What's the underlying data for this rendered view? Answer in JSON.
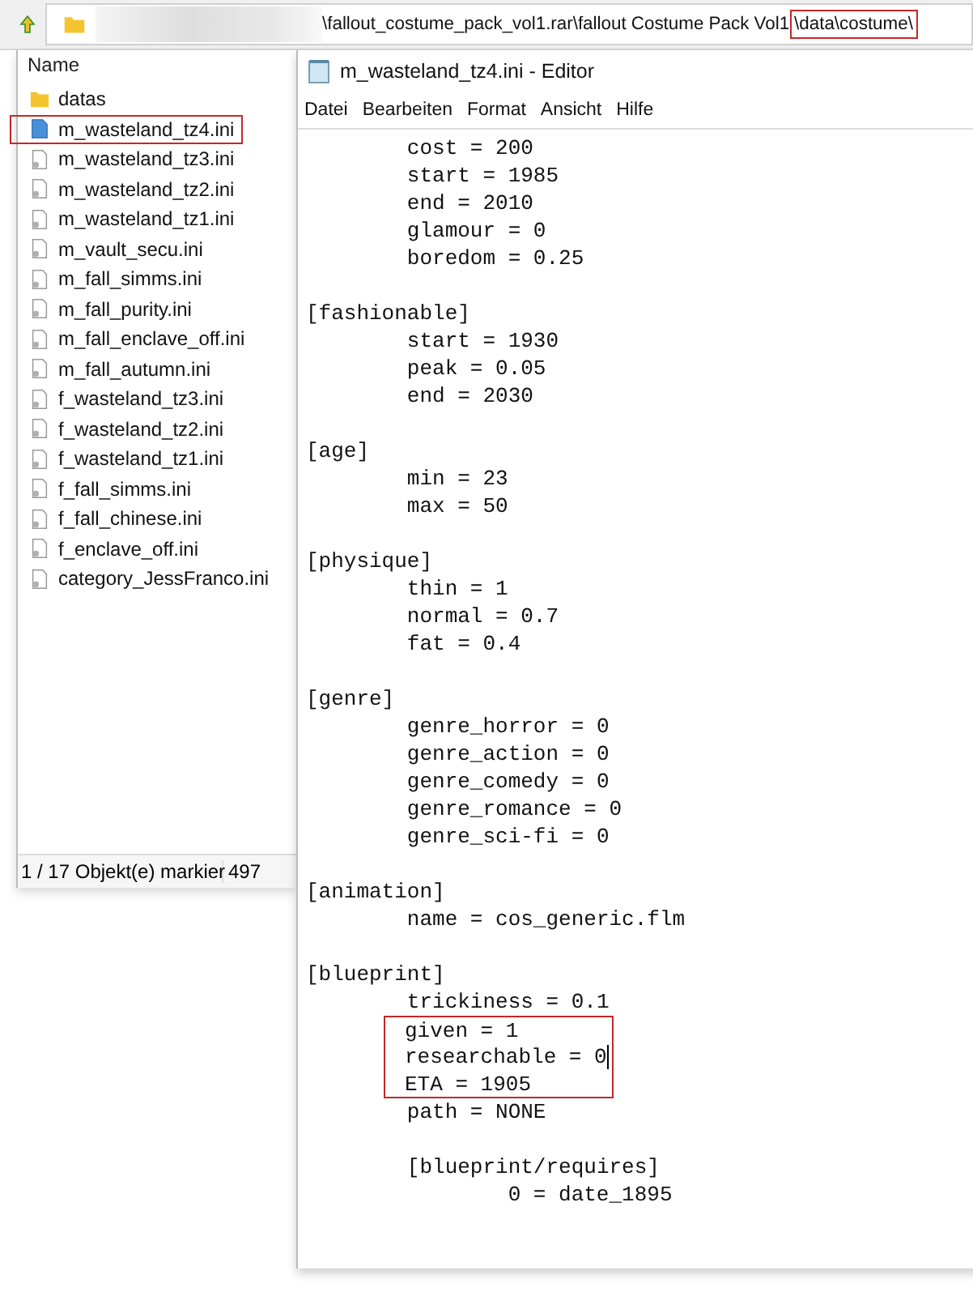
{
  "explorer": {
    "address": {
      "segments": [
        {
          "text": "\\fallout_costume_pack_vol1.rar\\fallout Costume Pack Vol1",
          "highlighted": false
        },
        {
          "text": "\\data\\costume\\",
          "highlighted": true
        }
      ]
    },
    "list": {
      "header": "Name",
      "items": [
        {
          "name": "datas",
          "kind": "folder",
          "highlighted": false
        },
        {
          "name": "m_wasteland_tz4.ini",
          "kind": "notepad_file",
          "highlighted": true
        },
        {
          "name": "m_wasteland_tz3.ini",
          "kind": "file",
          "highlighted": false
        },
        {
          "name": "m_wasteland_tz2.ini",
          "kind": "file",
          "highlighted": false
        },
        {
          "name": "m_wasteland_tz1.ini",
          "kind": "file",
          "highlighted": false
        },
        {
          "name": "m_vault_secu.ini",
          "kind": "file",
          "highlighted": false
        },
        {
          "name": "m_fall_simms.ini",
          "kind": "file",
          "highlighted": false
        },
        {
          "name": "m_fall_purity.ini",
          "kind": "file",
          "highlighted": false
        },
        {
          "name": "m_fall_enclave_off.ini",
          "kind": "file",
          "highlighted": false
        },
        {
          "name": "m_fall_autumn.ini",
          "kind": "file",
          "highlighted": false
        },
        {
          "name": "f_wasteland_tz3.ini",
          "kind": "file",
          "highlighted": false
        },
        {
          "name": "f_wasteland_tz2.ini",
          "kind": "file",
          "highlighted": false
        },
        {
          "name": "f_wasteland_tz1.ini",
          "kind": "file",
          "highlighted": false
        },
        {
          "name": "f_fall_simms.ini",
          "kind": "file",
          "highlighted": false
        },
        {
          "name": "f_fall_chinese.ini",
          "kind": "file",
          "highlighted": false
        },
        {
          "name": "f_enclave_off.ini",
          "kind": "file",
          "highlighted": false
        },
        {
          "name": "category_JessFranco.ini",
          "kind": "file",
          "highlighted": false
        }
      ]
    },
    "status_bar": [
      "1 / 17 Objekt(e) markier",
      "497"
    ]
  },
  "editor": {
    "title": "m_wasteland_tz4.ini - Editor",
    "menu": [
      "Datei",
      "Bearbeiten",
      "Format",
      "Ansicht",
      "Hilfe"
    ],
    "lines": [
      {
        "text": "\tcost = 200",
        "highlighted": false,
        "cursor": false
      },
      {
        "text": "\tstart = 1985",
        "highlighted": false,
        "cursor": false
      },
      {
        "text": "\tend = 2010",
        "highlighted": false,
        "cursor": false
      },
      {
        "text": "\tglamour = 0",
        "highlighted": false,
        "cursor": false
      },
      {
        "text": "\tboredom = 0.25",
        "highlighted": false,
        "cursor": false
      },
      {
        "highlighted": false,
        "cursor": false
      },
      {
        "text": "[fashionable]",
        "highlighted": false,
        "cursor": false
      },
      {
        "text": "\tstart = 1930",
        "highlighted": false,
        "cursor": false
      },
      {
        "text": "\tpeak = 0.05",
        "highlighted": false,
        "cursor": false
      },
      {
        "text": "\tend = 2030",
        "highlighted": false,
        "cursor": false
      },
      {
        "highlighted": false,
        "cursor": false
      },
      {
        "text": "[age]",
        "highlighted": false,
        "cursor": false
      },
      {
        "text": "\tmin = 23",
        "highlighted": false,
        "cursor": false
      },
      {
        "text": "\tmax = 50",
        "highlighted": false,
        "cursor": false
      },
      {
        "highlighted": false,
        "cursor": false
      },
      {
        "text": "[physique]",
        "highlighted": false,
        "cursor": false
      },
      {
        "text": "\tthin = 1",
        "highlighted": false,
        "cursor": false
      },
      {
        "text": "\tnormal = 0.7",
        "highlighted": false,
        "cursor": false
      },
      {
        "text": "\tfat = 0.4",
        "highlighted": false,
        "cursor": false
      },
      {
        "highlighted": false,
        "cursor": false
      },
      {
        "text": "[genre]",
        "highlighted": false,
        "cursor": false
      },
      {
        "text": "\tgenre_horror = 0",
        "highlighted": false,
        "cursor": false
      },
      {
        "text": "\tgenre_action = 0",
        "highlighted": false,
        "cursor": false
      },
      {
        "text": "\tgenre_comedy = 0",
        "highlighted": false,
        "cursor": false
      },
      {
        "text": "\tgenre_romance = 0",
        "highlighted": false,
        "cursor": false
      },
      {
        "text": "\tgenre_sci-fi = 0",
        "highlighted": false,
        "cursor": false
      },
      {
        "highlighted": false,
        "cursor": false
      },
      {
        "text": "[animation]",
        "highlighted": false,
        "cursor": false
      },
      {
        "text": "\tname = cos_generic.flm",
        "highlighted": false,
        "cursor": false
      },
      {
        "highlighted": false,
        "cursor": false
      },
      {
        "text": "[blueprint]",
        "highlighted": false,
        "cursor": false
      },
      {
        "text": "\ttrickiness = 0.1",
        "highlighted": false,
        "cursor": false
      },
      {
        "text": "\tgiven = 1",
        "highlighted": true,
        "cursor": false
      },
      {
        "text": "\tresearchable = 0",
        "highlighted": true,
        "cursor": true
      },
      {
        "text": "\tETA = 1905",
        "highlighted": true,
        "cursor": false
      },
      {
        "text": "\tpath = NONE",
        "highlighted": false,
        "cursor": false
      },
      {
        "highlighted": false,
        "cursor": false
      },
      {
        "text": "\t[blueprint/requires]",
        "highlighted": false,
        "cursor": false
      },
      {
        "text": "\t\t0 = date_1895",
        "highlighted": false,
        "cursor": false
      }
    ]
  }
}
